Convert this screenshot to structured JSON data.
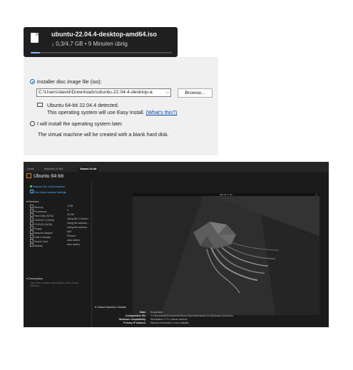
{
  "download": {
    "filename": "ubuntu-22.04.4-desktop-amd64.iso",
    "status": "↓ 0,3/4,7 GB • 9 Minuten übrig",
    "progress": 0.064,
    "icon": "file-icon"
  },
  "install_source": {
    "option_iso": "Installer disc image file (iso):",
    "iso_path": "C:\\Users\\david\\Downloads\\ubuntu-22.04.4-desktop-a",
    "browse": "Browse...",
    "detected": "Ubuntu 64-bit 22.04.4 detected.",
    "easy_install": "This operating system will use Easy Install.",
    "whats_this": "(What's this?)",
    "option_later": "I will install the operating system later.",
    "later_note": "The virtual machine will be created with a blank hard disk."
  },
  "vmware": {
    "tabs": [
      "Home",
      "Windows 10 x64",
      "Ubuntu 64-bit"
    ],
    "title": "Ubuntu 64-bit",
    "actions": [
      "Resume this virtual machine",
      "Edit virtual machine settings"
    ],
    "devices_header": "Devices",
    "devices": [
      {
        "name": "Memory",
        "value": "4 GB"
      },
      {
        "name": "Processors",
        "value": "4"
      },
      {
        "name": "Hard Disk (SCSI)",
        "value": "25 GB"
      },
      {
        "name": "CD/DVD 2 (SATA)",
        "value": "Using file C:\\Users..."
      },
      {
        "name": "CD/DVD (SATA)",
        "value": "Using file autoinst..."
      },
      {
        "name": "Floppy",
        "value": "Using file autoinst..."
      },
      {
        "name": "Network Adapter",
        "value": "NAT"
      },
      {
        "name": "USB Controller",
        "value": "Present"
      },
      {
        "name": "Sound Card",
        "value": "Auto detect"
      },
      {
        "name": "Display",
        "value": "Auto detect"
      }
    ],
    "description_header": "Description",
    "description_placeholder": "Type here to enter a description of this virtual machine.",
    "details_header": "Virtual Machine Details",
    "details": [
      {
        "key": "State:",
        "value": "Suspended"
      },
      {
        "key": "Configuration file:",
        "value": "C:\\Users\\david\\Documents\\Virtual Machines\\Ubuntu 64-bit\\Ubuntu 64-bit.vmx"
      },
      {
        "key": "Hardware compatibility:",
        "value": "Workstation 17.5.x virtual machine"
      },
      {
        "key": "Primary IP address:",
        "value": "Network information is not available"
      }
    ],
    "guest_clock": "Mar 31 17:42",
    "colors": {
      "accent": "#4fb3ff",
      "background": "#1b1b1b",
      "tab_bar": "#262626"
    }
  }
}
